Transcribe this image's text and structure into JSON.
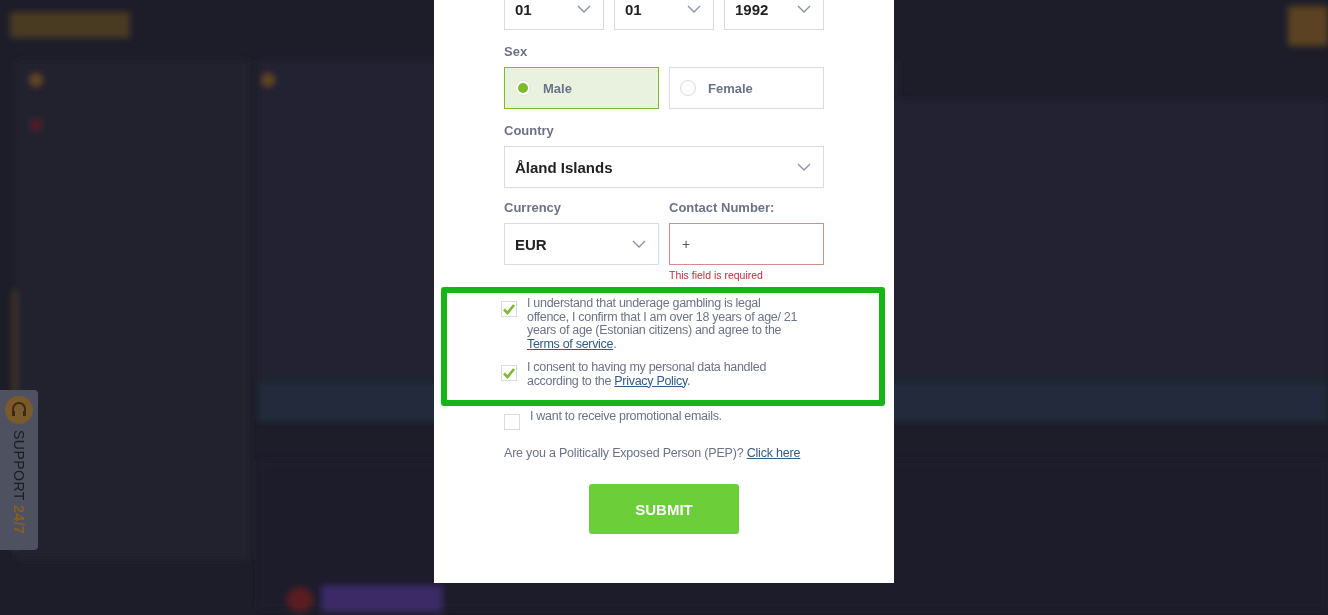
{
  "support": {
    "label": "SUPPORT",
    "hours": "24/7"
  },
  "dialog": {
    "birth_date": [
      {
        "value": "01"
      },
      {
        "value": "01"
      },
      {
        "value": "1992"
      }
    ],
    "sex": {
      "label": "Sex",
      "options": [
        {
          "label": "Male",
          "selected": true
        },
        {
          "label": "Female",
          "selected": false
        }
      ]
    },
    "country": {
      "label": "Country",
      "value": "Åland Islands"
    },
    "currency": {
      "label": "Currency",
      "value": "EUR"
    },
    "contact": {
      "label": "Contact Number:",
      "value": "+",
      "error": "This field is required"
    },
    "consents": [
      {
        "checked": true,
        "highlighted": true,
        "text": "I understand that underage gambling is legal offence, I confirm that I am over 18 years of age/ 21 years of age (Estonian citizens) and agree to the ",
        "link": "Terms of service",
        "after": "."
      },
      {
        "checked": true,
        "highlighted": true,
        "text": "I consent to having my personal data handled according to the ",
        "link": "Privacy Policy",
        "after": "."
      },
      {
        "checked": false,
        "highlighted": false,
        "text": "I want to receive promotional emails."
      }
    ],
    "pep": {
      "text": "Are you a Politically Exposed Person (PEP)? ",
      "link": "Click here"
    },
    "submit": "SUBMIT"
  }
}
